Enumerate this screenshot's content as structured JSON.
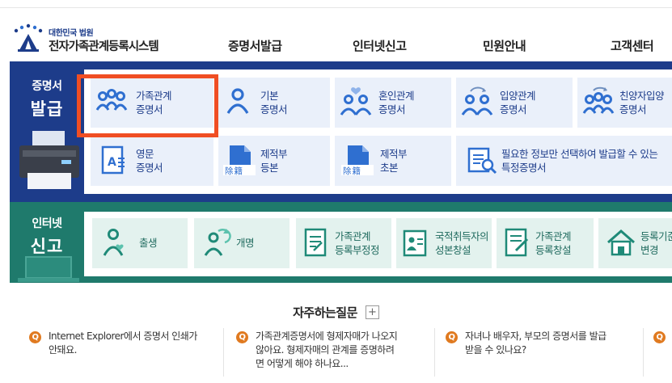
{
  "header": {
    "logo_small": "대한민국 법원",
    "logo_title": "전자가족관계등록시스템",
    "nav": [
      "증명서발급",
      "인터넷신고",
      "민원안내",
      "고객센터"
    ]
  },
  "categories": {
    "certificate": {
      "line1": "증명서",
      "line2": "발급"
    },
    "report": {
      "line1": "인터넷",
      "line2": "신고"
    }
  },
  "certificate_tiles": [
    {
      "line1": "가족관계",
      "line2": "증명서",
      "icon": "family-icon"
    },
    {
      "line1": "기본",
      "line2": "증명서",
      "icon": "person-icon"
    },
    {
      "line1": "혼인관계",
      "line2": "증명서",
      "icon": "couple-heart-icon"
    },
    {
      "line1": "입양관계",
      "line2": "증명서",
      "icon": "adoption-icon"
    },
    {
      "line1": "친양자입양",
      "line2": "증명서",
      "icon": "family-adoption-icon"
    },
    {
      "line1": "영문",
      "line2": "증명서",
      "icon": "english-document-icon"
    },
    {
      "line1": "제적부",
      "line2": "등본",
      "icon": "register-document-icon",
      "badge": "除籍"
    },
    {
      "line1": "제적부",
      "line2": "초본",
      "icon": "register-document-icon",
      "badge": "除籍"
    },
    {
      "line1": "필요한 정보만 선택하여 발급할 수 있는",
      "line2": "특정증명서",
      "icon": "search-document-icon"
    }
  ],
  "report_tiles": [
    {
      "line1": "출생",
      "icon": "baby-icon"
    },
    {
      "line1": "개명",
      "icon": "rename-icon"
    },
    {
      "line1": "가족관계",
      "line2": "등록부정정",
      "icon": "edit-document-icon"
    },
    {
      "line1": "국적취득자의",
      "line2": "성본창설",
      "icon": "id-card-icon"
    },
    {
      "line1": "가족관계",
      "line2": "등록창설",
      "icon": "create-document-icon"
    },
    {
      "line1": "등록기준지",
      "line2": "변경",
      "icon": "house-icon"
    }
  ],
  "faq": {
    "title": "자주하는질문",
    "plus": "+",
    "q_badge": "Q",
    "items": [
      {
        "line1": "Internet Explorer에서 증명서 인쇄가",
        "line2": "안돼요."
      },
      {
        "line1": "가족관계증명서에 형제자매가 나오지",
        "line2": "않아요. 형제자매의 관계를 증명하려",
        "line3": "면 어떻게 해야 하나요..."
      },
      {
        "line1": "자녀나 배우자, 부모의 증명서를 발급",
        "line2": "받을 수 있나요?"
      },
      {
        "line1": ""
      }
    ]
  },
  "colors": {
    "certificate_band": "#1d3c8a",
    "report_band": "#1f7a6c",
    "tile_blue": "#eaf0fa",
    "tile_green": "#e3f2ee",
    "highlight": "#f04e23",
    "faq_badge": "#e07a20"
  }
}
